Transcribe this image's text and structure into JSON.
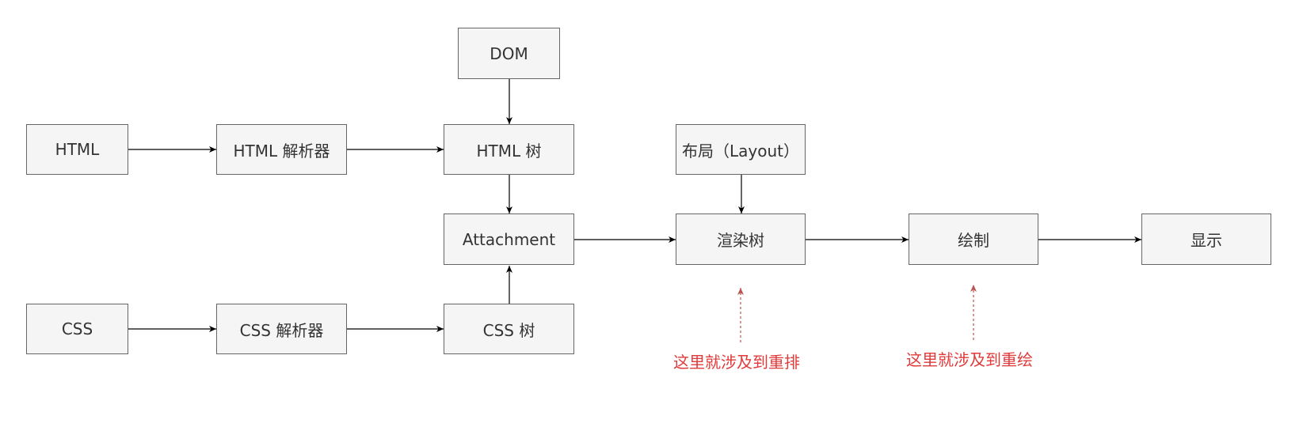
{
  "diagram": {
    "nodes": {
      "dom": "DOM",
      "html": "HTML",
      "html_parser": "HTML 解析器",
      "html_tree": "HTML 树",
      "layout": "布局（Layout）",
      "attachment": "Attachment",
      "render_tree": "渲染树",
      "paint": "绘制",
      "display": "显示",
      "css": "CSS",
      "css_parser": "CSS 解析器",
      "css_tree": "CSS 树"
    },
    "notes": {
      "reflow": "这里就涉及到重排",
      "repaint": "这里就涉及到重绘"
    },
    "colors": {
      "node_fill": "#f5f5f5",
      "node_border": "#666666",
      "edge": "#000000",
      "note_text": "#e03a3a",
      "note_arrow": "#b85450"
    }
  }
}
